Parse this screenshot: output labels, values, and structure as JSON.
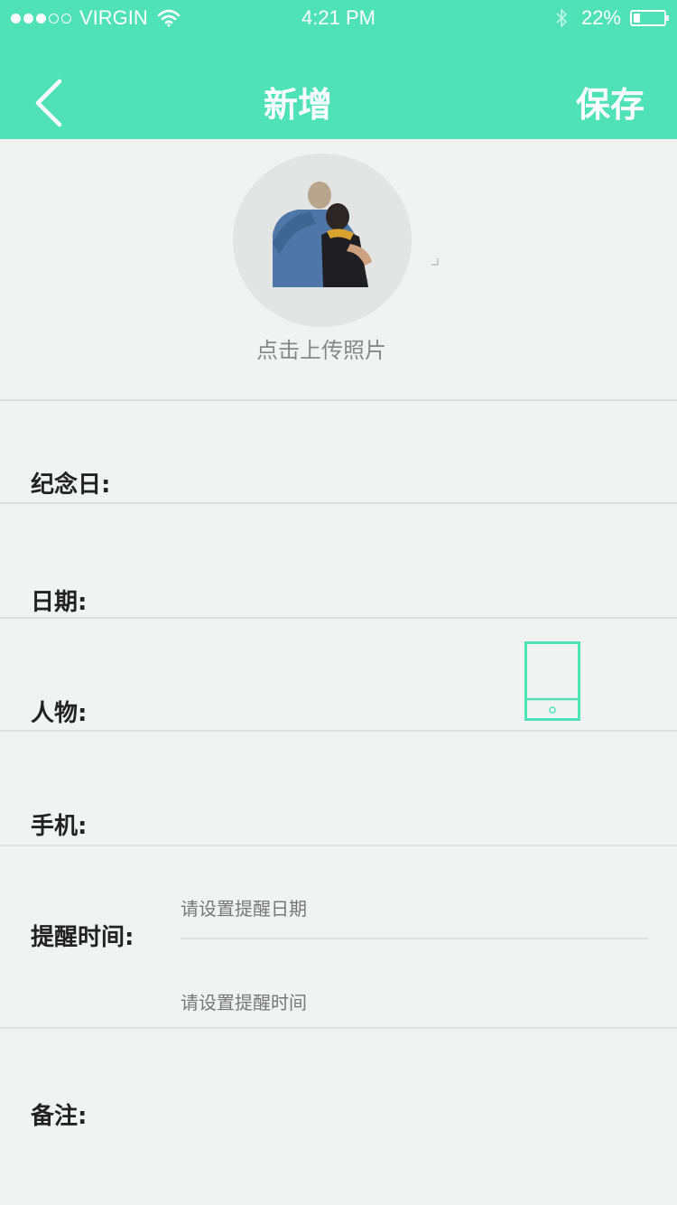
{
  "status_bar": {
    "carrier": "VIRGIN",
    "time": "4:21 PM",
    "battery": "22%",
    "battery_level": 0.22,
    "signal_bars_filled": 3,
    "signal_bars_total": 5
  },
  "nav": {
    "title": "新增",
    "save_label": "保存"
  },
  "photo": {
    "upload_label": "点击上传照片"
  },
  "form": {
    "anniversary_label": "纪念日:",
    "date_label": "日期:",
    "person_label": "人物:",
    "phone_label": "手机:",
    "reminder_label": "提醒时间:",
    "reminder_date_placeholder": "请设置提醒日期",
    "reminder_time_placeholder": "请设置提醒时间",
    "notes_label": "备注:"
  },
  "colors": {
    "accent": "#50e2b7",
    "background": "#f1f3f2",
    "divider": "#dde0df"
  }
}
